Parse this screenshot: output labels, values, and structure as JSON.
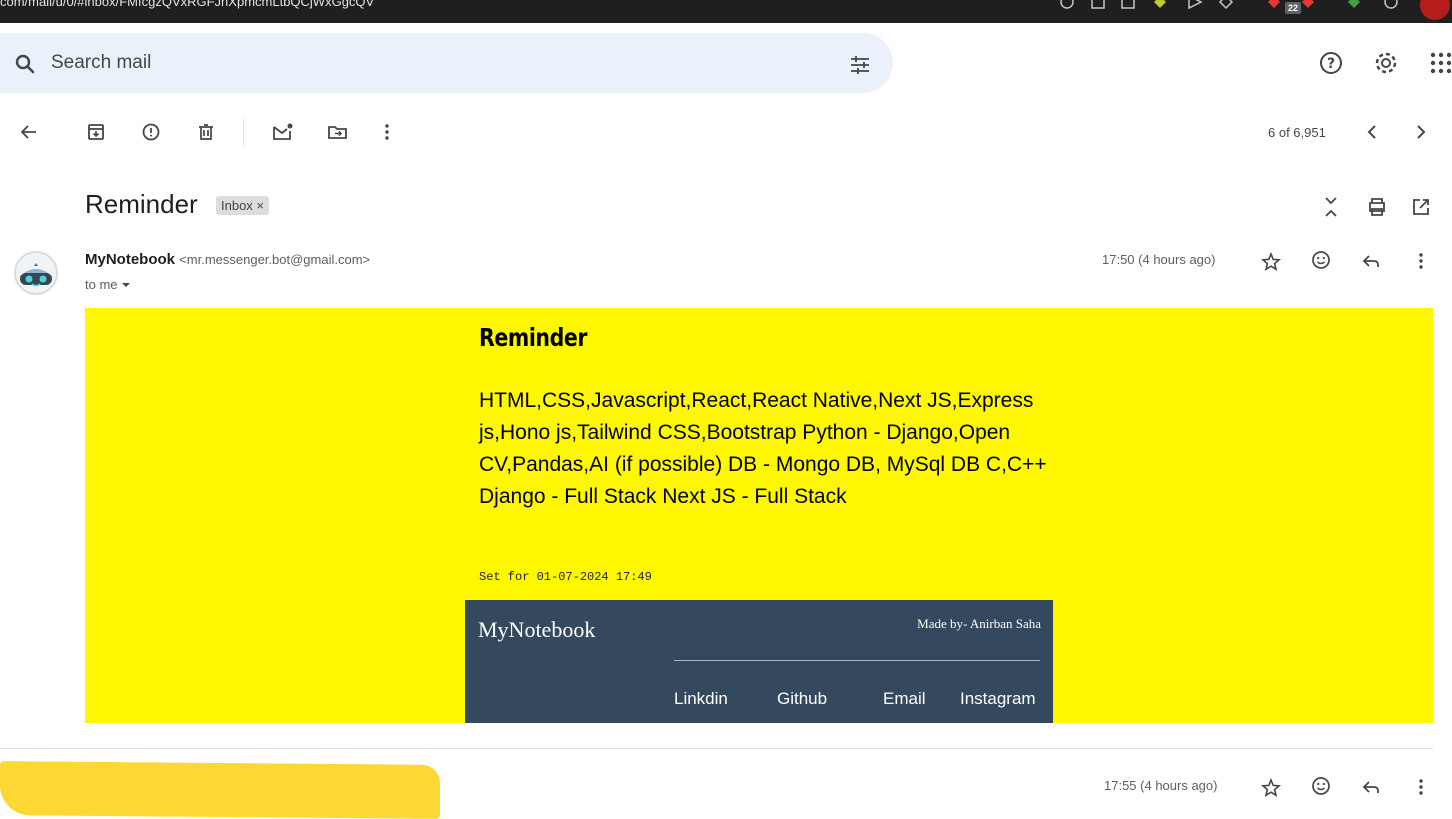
{
  "browser": {
    "url": "com/mail/u/0/#inbox/FMfcgzQVxRGFJhXpmcmLtbQCjWxGgcQV",
    "badge_count": "22"
  },
  "search": {
    "placeholder": "Search mail"
  },
  "toolbar": {
    "pager": "6 of 6,951"
  },
  "thread": {
    "subject": "Reminder",
    "label_chip": "Inbox ×"
  },
  "message": {
    "sender_name": "MyNotebook",
    "sender_email": "<mr.messenger.bot@gmail.com>",
    "recipient": "to me",
    "time": "17:50 (4 hours ago)"
  },
  "email_body": {
    "title": "Reminder",
    "body": "HTML,CSS,Javascript,React,React Native,Next JS,Express js,Hono js,Tailwind CSS,Bootstrap Python - Django,Open CV,Pandas,AI (if possible) DB - Mongo DB, MySql DB C,C++ Django - Full Stack Next JS - Full Stack",
    "set_for": "Set for 01-07-2024 17:49",
    "footer_brand": "MyNotebook",
    "footer_made_by": "Made by- Anirban Saha",
    "footer_links": [
      "Linkdin",
      "Github",
      "Email",
      "Instagram"
    ]
  },
  "next_message": {
    "time": "17:55 (4 hours ago)"
  },
  "colors": {
    "email_background": "#fff700",
    "footer_background": "#34495e",
    "search_background": "#eaf1fb"
  },
  "icons": [
    "search-icon",
    "tune-icon",
    "help-icon",
    "settings-icon",
    "apps-icon",
    "back-arrow-icon",
    "archive-icon",
    "report-spam-icon",
    "delete-icon",
    "mark-unread-icon",
    "move-to-icon",
    "more-vert-icon",
    "chevron-left-icon",
    "chevron-right-icon",
    "collapse-all-icon",
    "print-icon",
    "open-new-window-icon",
    "star-icon",
    "emoji-reaction-icon",
    "reply-icon"
  ]
}
